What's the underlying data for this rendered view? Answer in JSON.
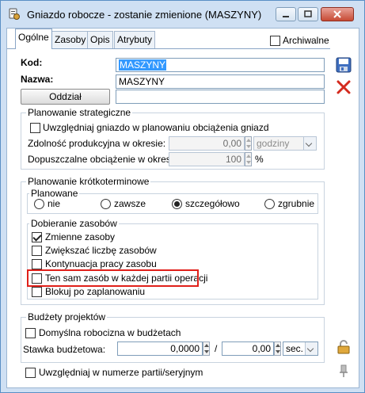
{
  "window": {
    "title": "Gniazdo robocze - zostanie zmienione  (MASZYNY)"
  },
  "tabs": [
    {
      "label": "Ogólne",
      "active": true
    },
    {
      "label": "Zasoby",
      "active": false
    },
    {
      "label": "Opis",
      "active": false
    },
    {
      "label": "Atrybuty",
      "active": false
    }
  ],
  "archiwalne": {
    "label": "Archiwalne",
    "checked": false
  },
  "kod": {
    "label": "Kod:",
    "value": "MASZYNY"
  },
  "nazwa": {
    "label": "Nazwa:",
    "value": "MASZYNY"
  },
  "oddzial": {
    "label": "Oddział",
    "value": ""
  },
  "strategic": {
    "title": "Planowanie strategiczne",
    "include_label": "Uwzględniaj gniazdo w planowaniu obciążenia gniazd",
    "include_checked": false,
    "capacity_label": "Zdolność produkcyjna w okresie:",
    "capacity_value": "0,00",
    "capacity_unit": "godziny",
    "load_label": "Dopuszczalne obciążenie w okresie:",
    "load_value": "100",
    "load_unit": "%"
  },
  "short_term": {
    "title": "Planowanie krótkoterminowe",
    "planned_title": "Planowane",
    "options": [
      {
        "label": "nie",
        "checked": false
      },
      {
        "label": "zawsze",
        "checked": false
      },
      {
        "label": "szczegółowo",
        "checked": true
      },
      {
        "label": "zgrubnie",
        "checked": false
      }
    ],
    "resources_title": "Dobieranie zasobów",
    "resource_checks": [
      {
        "label": "Zmienne zasoby",
        "checked": true
      },
      {
        "label": "Zwiększać liczbę zasobów",
        "checked": false
      },
      {
        "label": "Kontynuacja pracy zasobu",
        "checked": false
      },
      {
        "label": "Ten sam zasób w każdej partii operacji",
        "checked": false
      },
      {
        "label": "Blokuj po zaplanowaniu",
        "checked": false
      }
    ]
  },
  "budgets": {
    "title": "Budżety projektów",
    "default_label": "Domyślna robocizna w budżetach",
    "default_checked": false,
    "rate_label": "Stawka budżetowa:",
    "rate_value": "0,0000",
    "separator": "/",
    "per_value": "0,00",
    "per_unit": "sec."
  },
  "batch": {
    "label": "Uwzględniaj w numerze partii/seryjnym",
    "checked": false
  },
  "colors": {
    "accent": "#3399ff",
    "highlight": "#e0201a",
    "window_bg": "#cfe0f3"
  }
}
